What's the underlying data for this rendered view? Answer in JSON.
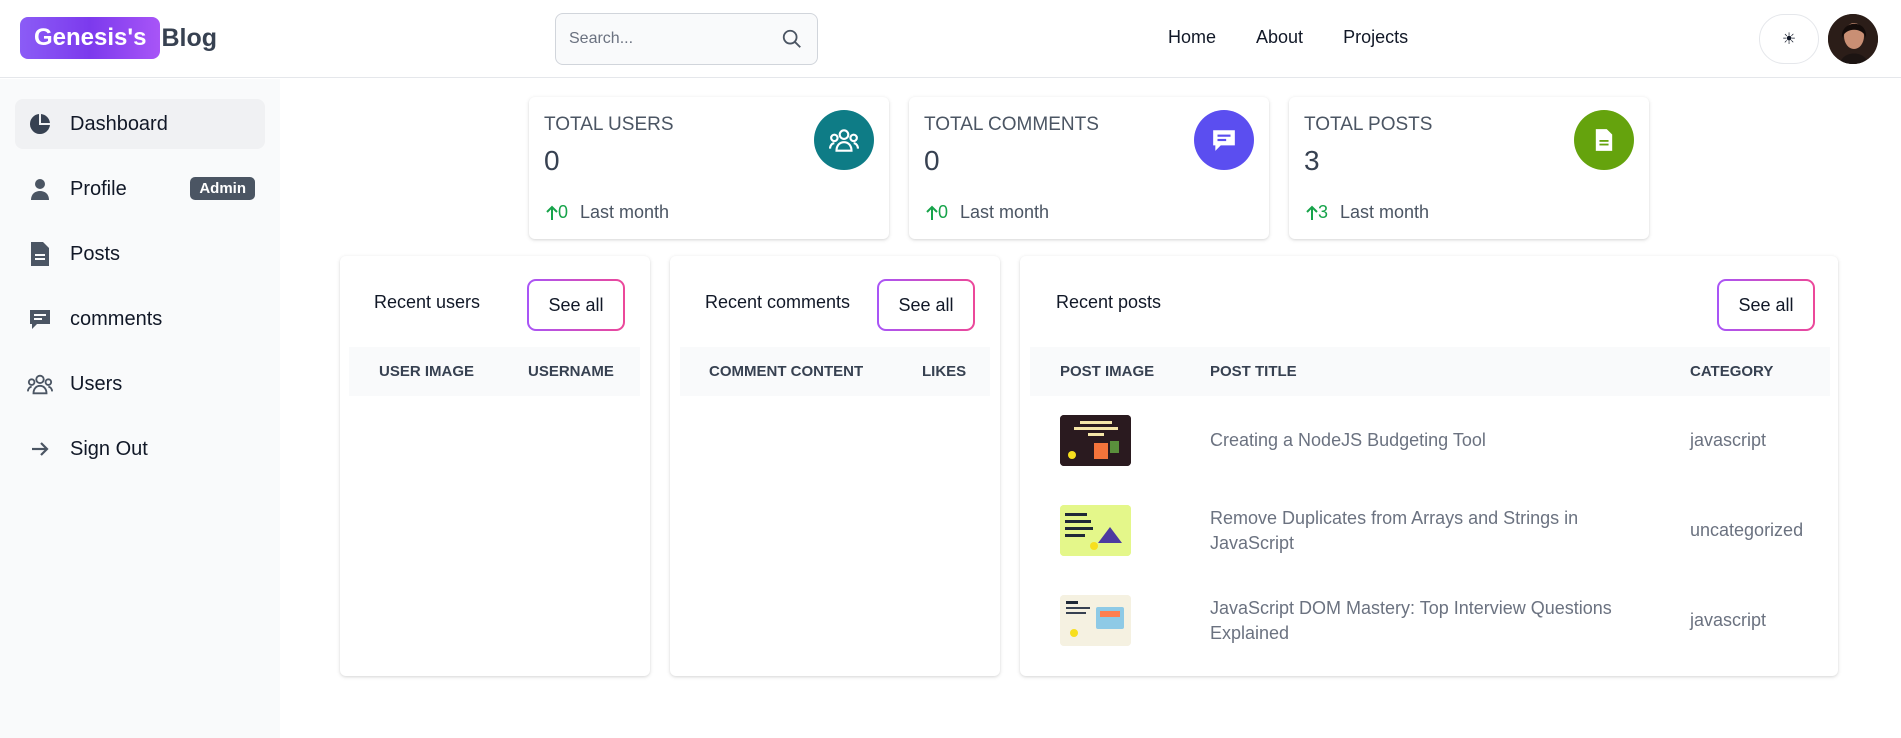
{
  "header": {
    "logo_badge": "Genesis's",
    "logo_text": "Blog",
    "search_placeholder": "Search...",
    "nav": [
      "Home",
      "About",
      "Projects"
    ],
    "theme_toggle": "☀"
  },
  "sidebar": {
    "items": [
      {
        "label": "Dashboard",
        "icon": "pie-chart-icon"
      },
      {
        "label": "Profile",
        "icon": "user-icon",
        "badge": "Admin"
      },
      {
        "label": "Posts",
        "icon": "document-icon"
      },
      {
        "label": "comments",
        "icon": "comment-icon"
      },
      {
        "label": "Users",
        "icon": "users-group-icon"
      },
      {
        "label": "Sign Out",
        "icon": "arrow-right-icon"
      }
    ]
  },
  "stats": [
    {
      "title": "Total Users",
      "value": "0",
      "delta": "0",
      "foot": "Last month",
      "icon": "users-group-icon",
      "color": "#0e7c86"
    },
    {
      "title": "Total Comments",
      "value": "0",
      "delta": "0",
      "foot": "Last month",
      "icon": "comment-icon",
      "color": "#5b4ef0"
    },
    {
      "title": "Total Posts",
      "value": "3",
      "delta": "3",
      "foot": "Last month",
      "icon": "document-icon",
      "color": "#65a30d"
    }
  ],
  "recent_users": {
    "title": "Recent users",
    "see_all": "See all",
    "columns": [
      "User image",
      "Username"
    ]
  },
  "recent_comments": {
    "title": "Recent comments",
    "see_all": "See all",
    "columns": [
      "Comment content",
      "Likes"
    ]
  },
  "recent_posts": {
    "title": "Recent posts",
    "see_all": "See all",
    "columns": [
      "Post image",
      "Post title",
      "Category"
    ],
    "rows": [
      {
        "title": "Creating a NodeJS Budgeting Tool",
        "category": "javascript"
      },
      {
        "title": "Remove Duplicates from Arrays and Strings in JavaScript",
        "category": "uncategorized"
      },
      {
        "title": "JavaScript DOM Mastery: Top Interview Questions Explained",
        "category": "javascript"
      }
    ]
  },
  "colors": {
    "accent_gradient_start": "#a855f7",
    "accent_gradient_end": "#ec4899",
    "logo_gradient": "#8b5cf6",
    "positive": "#16a34a"
  }
}
